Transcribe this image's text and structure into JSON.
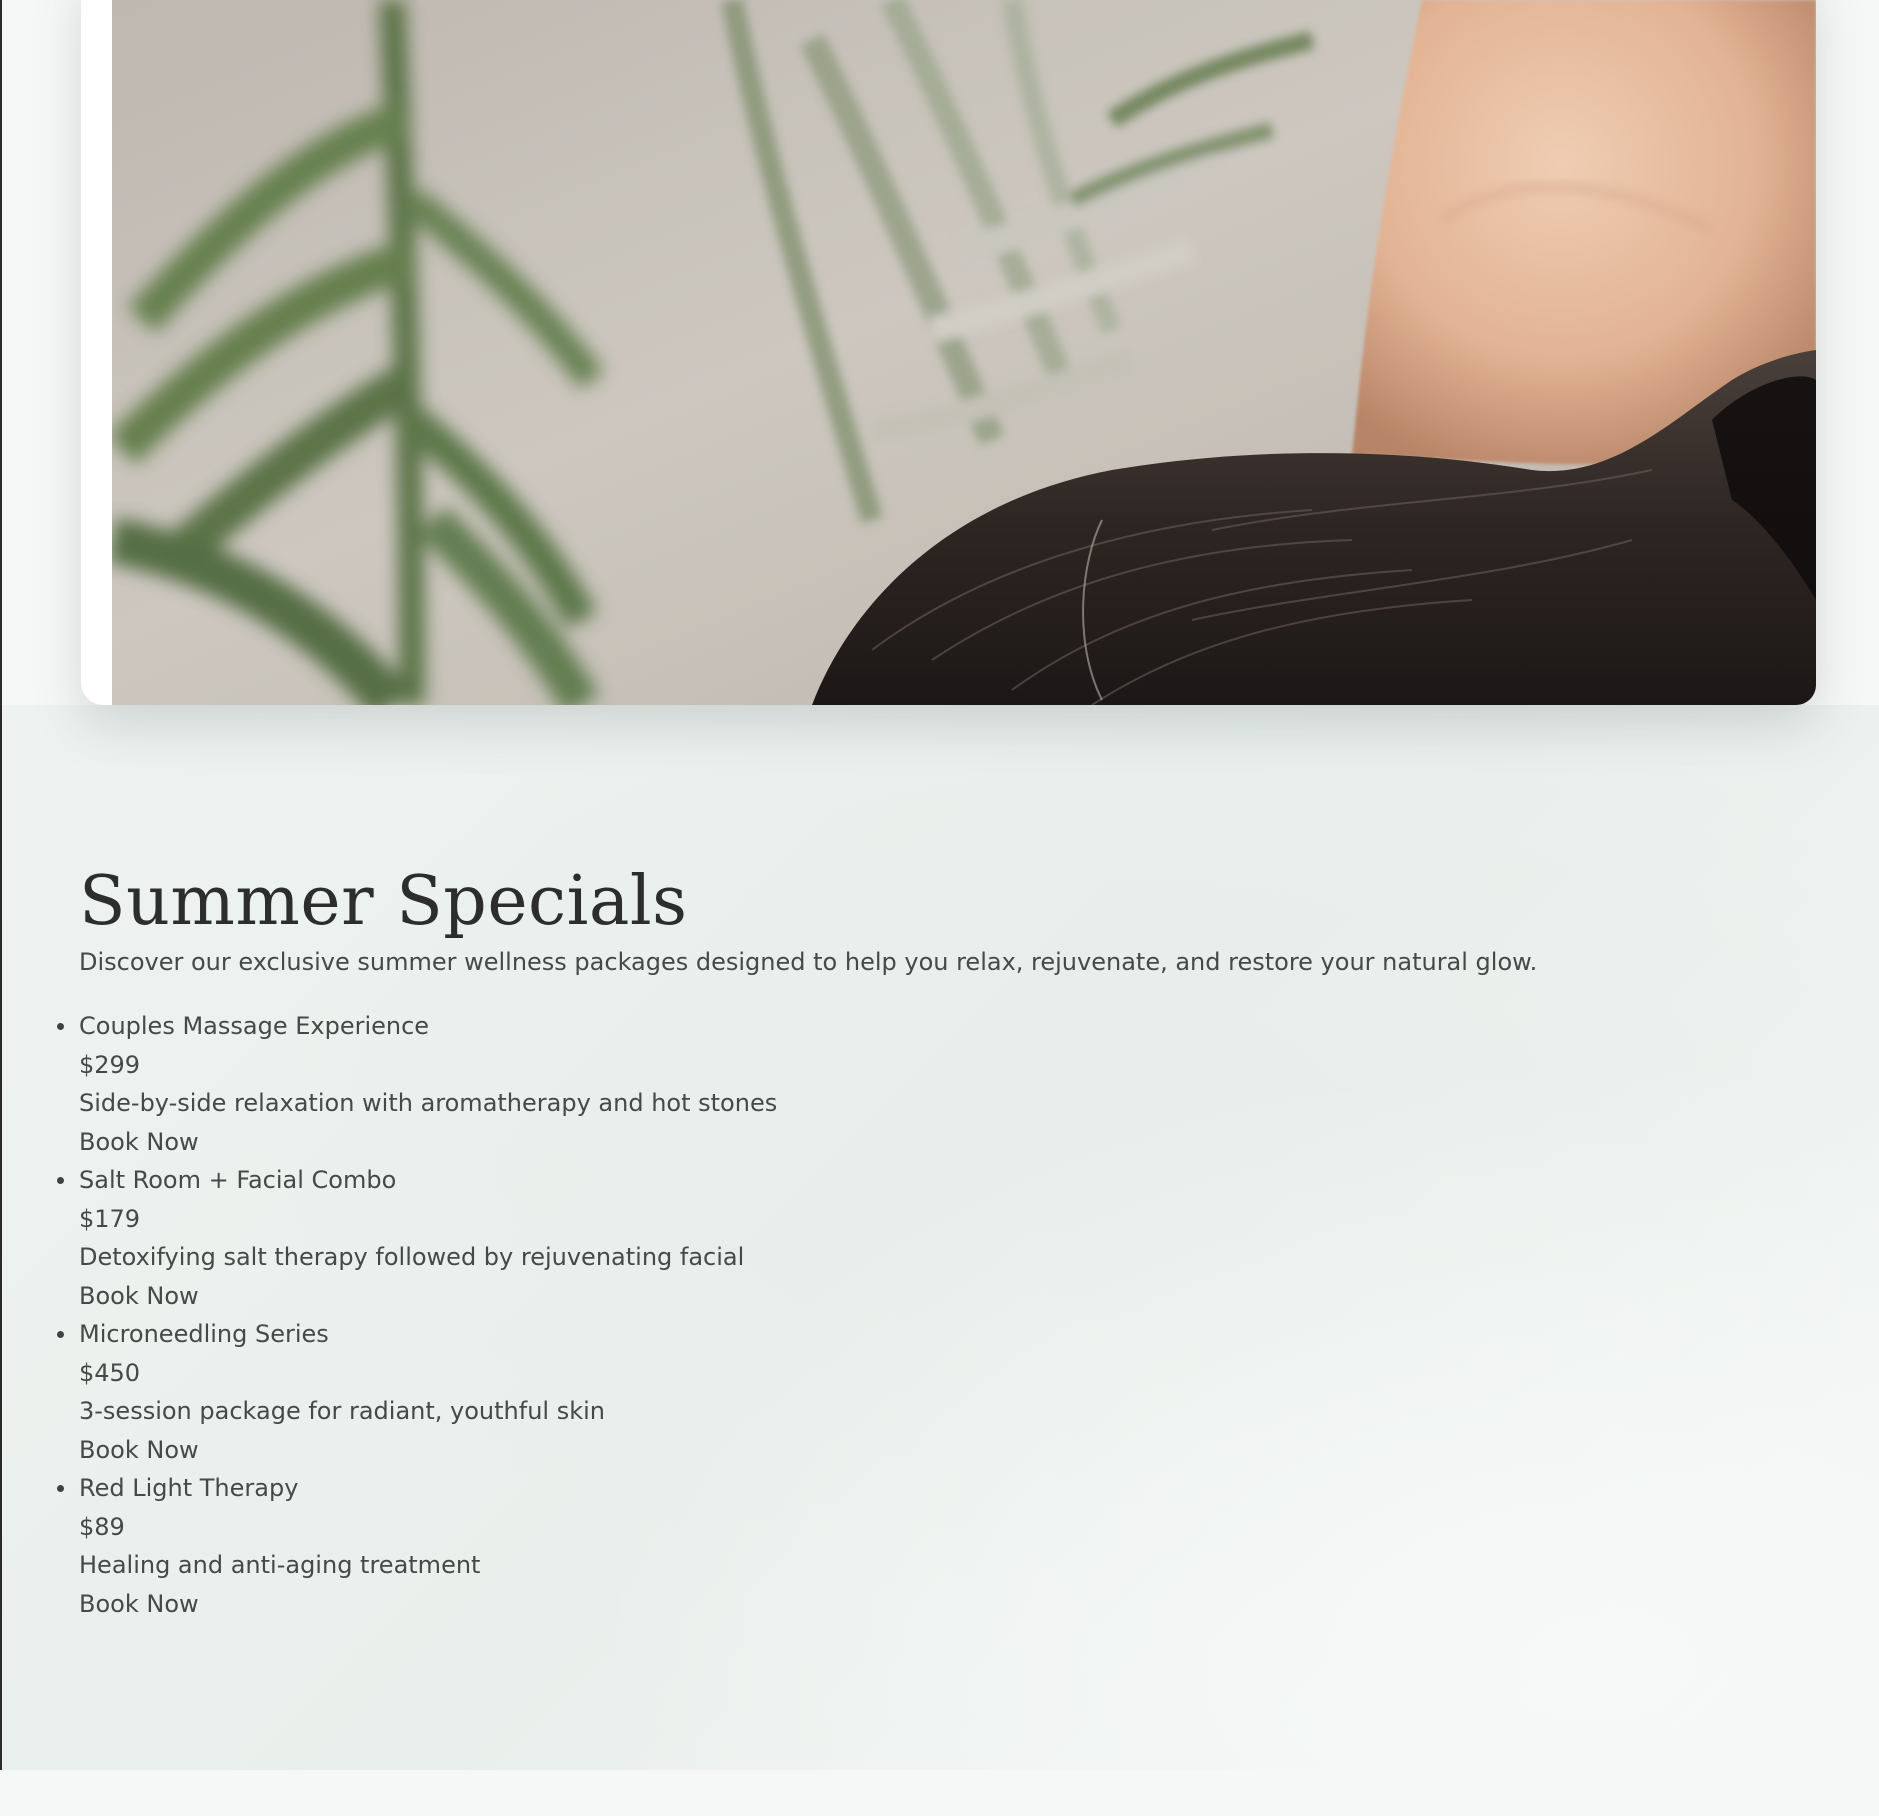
{
  "hero": {
    "image": "spa-client-with-palm-leaves-photo"
  },
  "specials": {
    "title": "Summer Specials",
    "intro": "Discover our exclusive summer wellness packages designed to help you relax, rejuvenate, and restore your natural glow.",
    "offers": [
      {
        "name": "Couples Massage Experience",
        "price": "$299",
        "description": "Side-by-side relaxation with aromatherapy and hot stones",
        "cta": "Book Now"
      },
      {
        "name": "Salt Room + Facial Combo",
        "price": "$179",
        "description": "Detoxifying salt therapy followed by rejuvenating facial",
        "cta": "Book Now"
      },
      {
        "name": "Microneedling Series",
        "price": "$450",
        "description": "3-session package for radiant, youthful skin",
        "cta": "Book Now"
      },
      {
        "name": "Red Light Therapy",
        "price": "$89",
        "description": "Healing and anti-aging treatment",
        "cta": "Book Now"
      }
    ]
  },
  "colors": {
    "heading": "#2b2e2c",
    "body_text": "#454a47",
    "section_bg": "#eaf0ed"
  }
}
